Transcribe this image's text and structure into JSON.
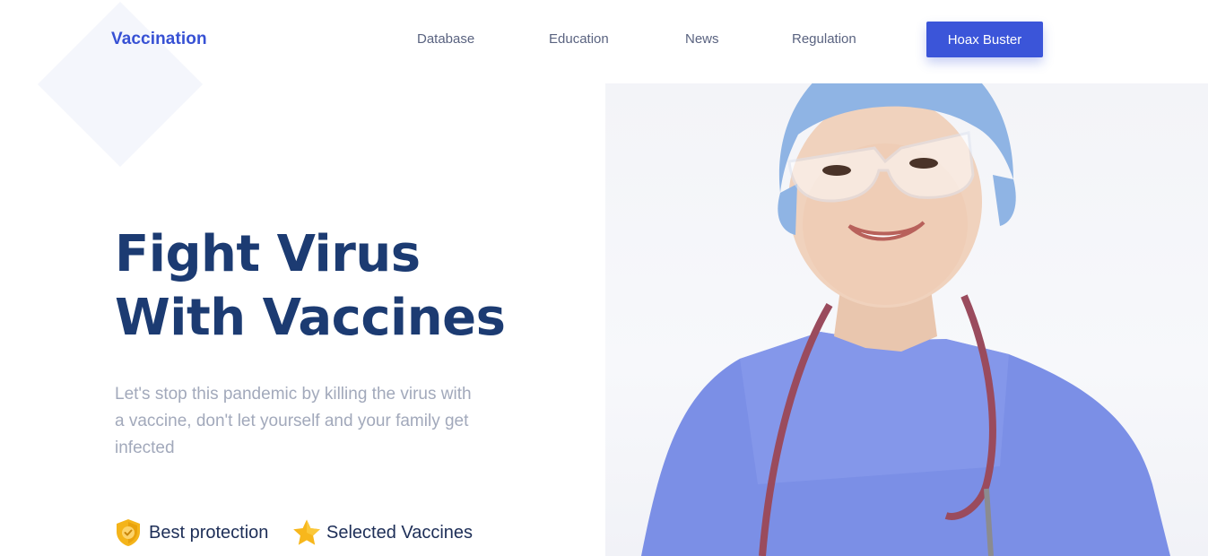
{
  "brand": {
    "name": "Vaccination"
  },
  "nav": {
    "items": [
      {
        "label": "Database"
      },
      {
        "label": "Education"
      },
      {
        "label": "News"
      },
      {
        "label": "Regulation"
      }
    ],
    "cta_label": "Hoax Buster"
  },
  "hero": {
    "headline_line1": "Fight Virus",
    "headline_line2": "With Vaccines",
    "subtitle": "Let's stop this pandemic by killing the virus with a vaccine, don't let yourself and your family get infected",
    "features": [
      {
        "label": "Best protection",
        "icon": "shield-check-icon"
      },
      {
        "label": "Selected Vaccines",
        "icon": "star-icon"
      }
    ]
  },
  "colors": {
    "brand": "#3751d4",
    "button": "#3b55d9",
    "headline": "#1c3b72",
    "subtitle": "#a2a9bb",
    "nav_text": "#5a6380",
    "feature_icon": "#f4b41a"
  }
}
